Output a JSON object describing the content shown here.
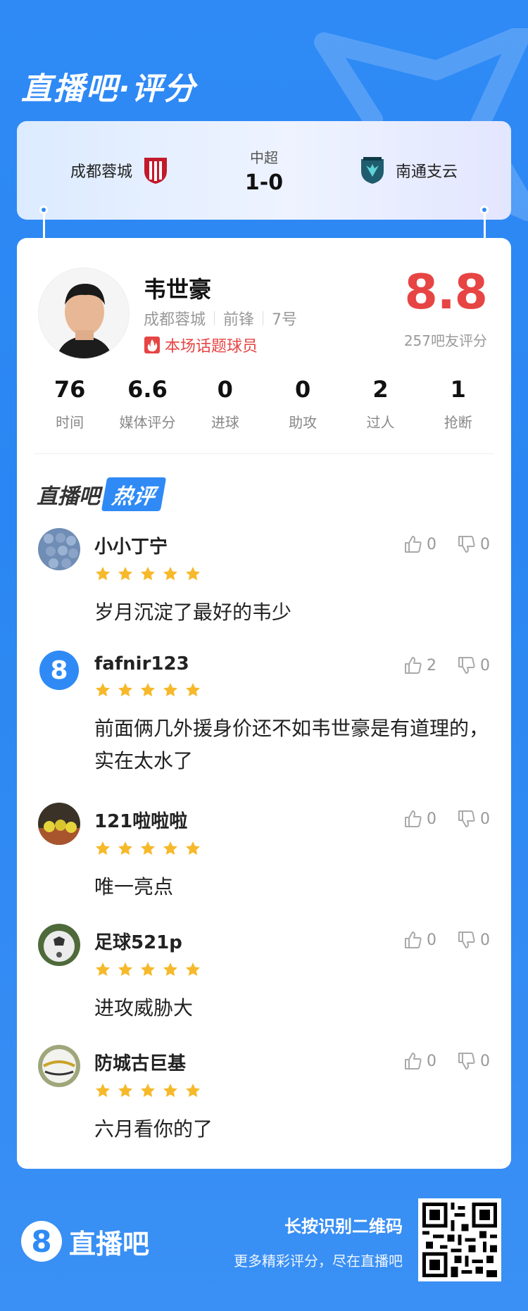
{
  "brand": {
    "title": "直播吧·评分"
  },
  "match": {
    "league": "中超",
    "score": "1-0",
    "home_team": "成都蓉城",
    "away_team": "南通支云"
  },
  "player": {
    "name": "韦世豪",
    "team": "成都蓉城",
    "position": "前锋",
    "number": "7号",
    "tag": "本场话题球员",
    "rating": "8.8",
    "rating_count": "257吧友评分"
  },
  "stats": [
    {
      "value": "76",
      "label": "时间"
    },
    {
      "value": "6.6",
      "label": "媒体评分"
    },
    {
      "value": "0",
      "label": "进球"
    },
    {
      "value": "0",
      "label": "助攻"
    },
    {
      "value": "2",
      "label": "过人"
    },
    {
      "value": "1",
      "label": "抢断"
    }
  ],
  "hot_comments": {
    "title_part1": "直播吧",
    "title_part2": "热评",
    "items": [
      {
        "user": "小小丁宁",
        "stars": 5,
        "text": "岁月沉淀了最好的韦少",
        "likes": "0",
        "dislikes": "0"
      },
      {
        "user": "fafnir123",
        "stars": 5,
        "text": "前面俩几外援身价还不如韦世豪是有道理的，实在太水了",
        "likes": "2",
        "dislikes": "0"
      },
      {
        "user": "121啦啦啦",
        "stars": 5,
        "text": "唯一亮点",
        "likes": "0",
        "dislikes": "0"
      },
      {
        "user": "足球521p",
        "stars": 5,
        "text": "进攻威胁大",
        "likes": "0",
        "dislikes": "0"
      },
      {
        "user": "防城古巨基",
        "stars": 5,
        "text": "六月看你的了",
        "likes": "0",
        "dislikes": "0"
      }
    ]
  },
  "footer": {
    "logo_glyph": "8",
    "logo_text": "直播吧",
    "cta_line1": "长按识别二维码",
    "cta_line2": "更多精彩评分，尽在直播吧"
  },
  "colors": {
    "primary": "#2f8af5",
    "rating": "#e74444",
    "star": "#f6b92b"
  }
}
